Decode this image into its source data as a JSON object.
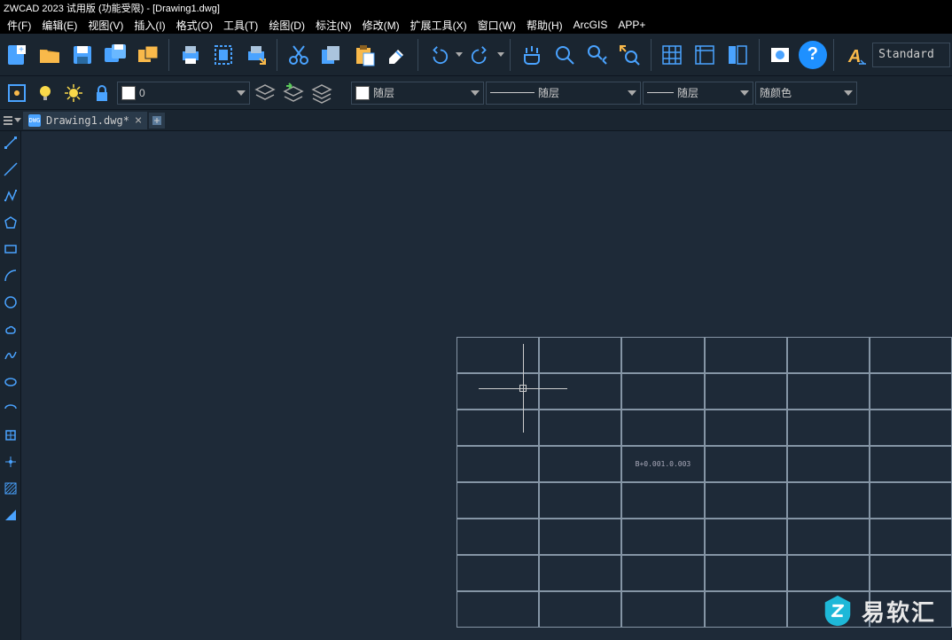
{
  "title": "ZWCAD 2023 试用版 (功能受限) - [Drawing1.dwg]",
  "menu": [
    "件(F)",
    "编辑(E)",
    "视图(V)",
    "插入(I)",
    "格式(O)",
    "工具(T)",
    "绘图(D)",
    "标注(N)",
    "修改(M)",
    "扩展工具(X)",
    "窗口(W)",
    "帮助(H)",
    "ArcGIS",
    "APP+"
  ],
  "style_label": "Standard",
  "layer_row": {
    "layer_name": "0",
    "linetype": "随层",
    "lineweight": "随层",
    "bylayer": "随层",
    "color": "随颜色"
  },
  "tab": {
    "name": "Drawing1.dwg*",
    "icon": "DWG"
  },
  "grid_text": "B+0.001.0.003",
  "watermark": "易软汇"
}
